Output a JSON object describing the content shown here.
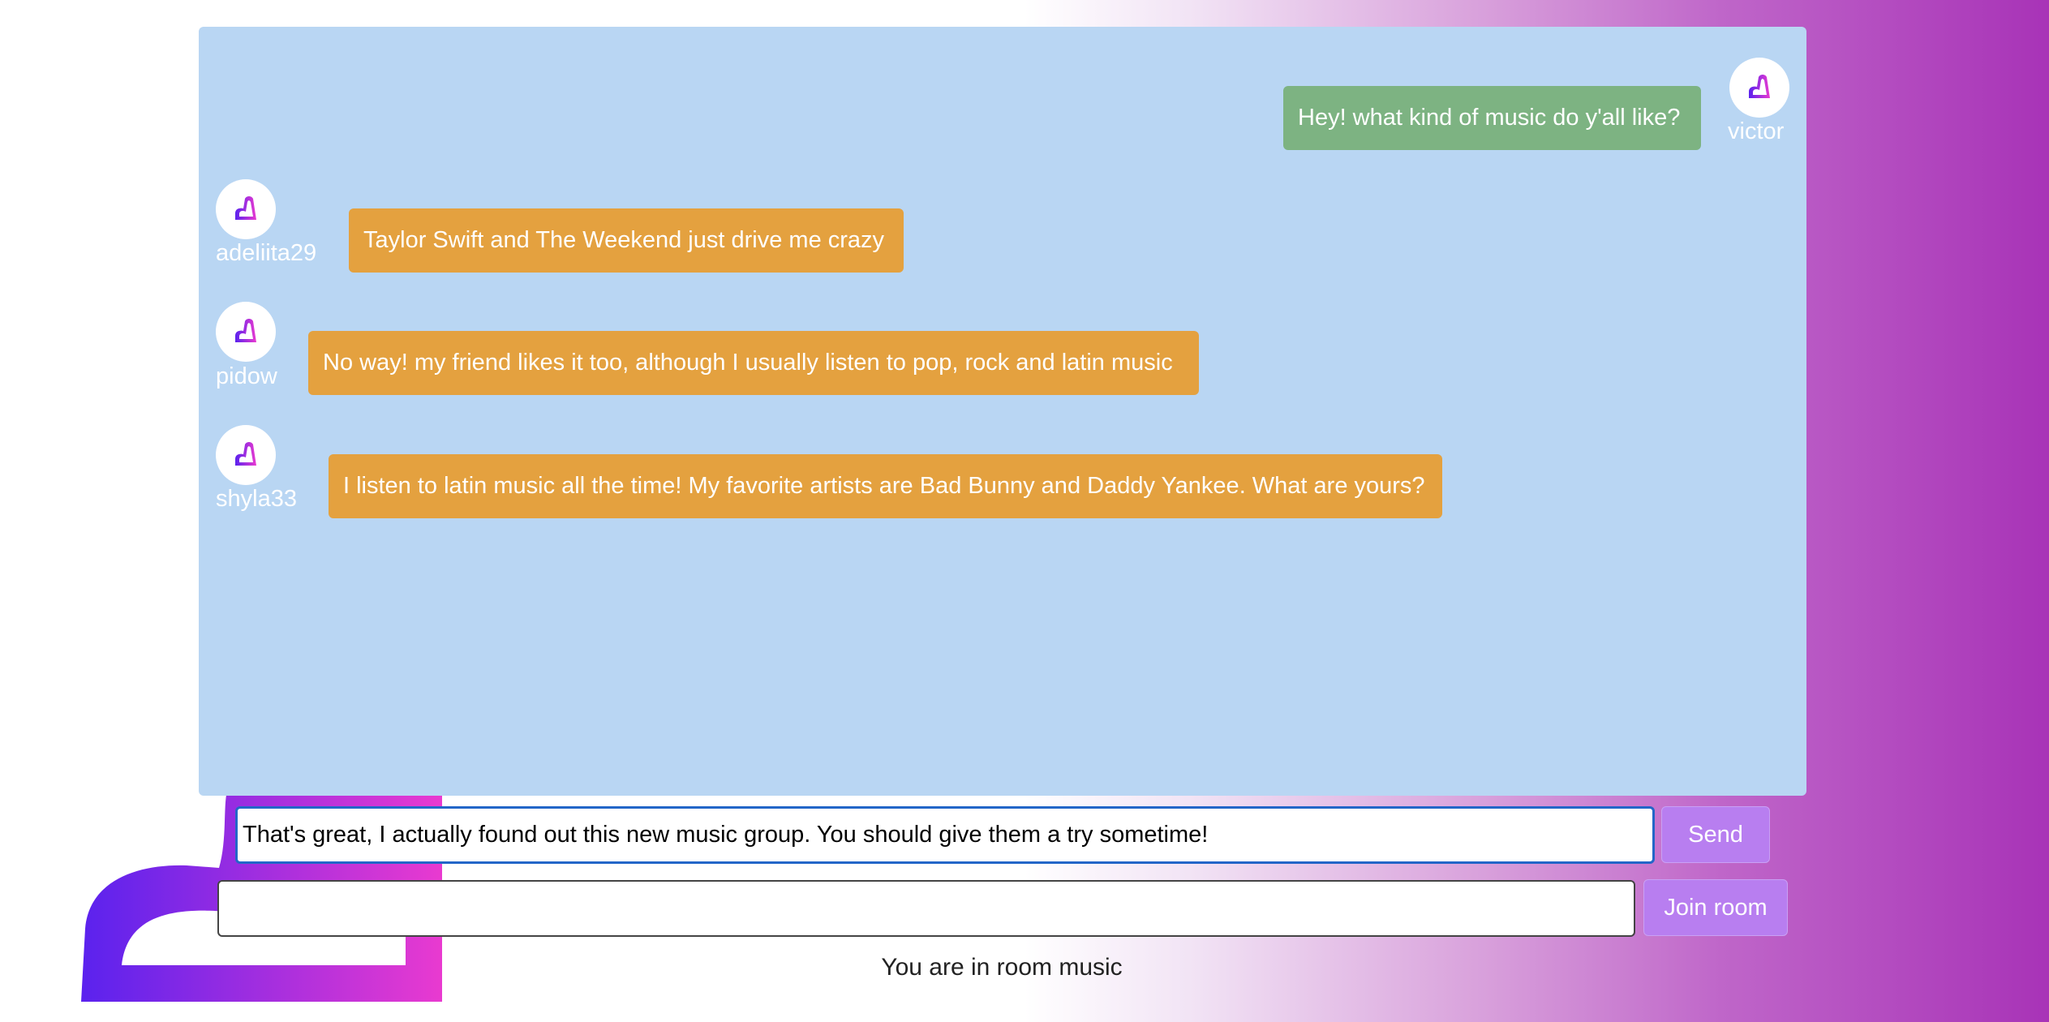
{
  "colors": {
    "panel": "#b9d6f3",
    "sent_bubble": "#7db382",
    "received_bubble": "#e4a13f",
    "button": "#b87ef0",
    "input_focus_border": "#2366c8"
  },
  "icons": {
    "avatar": "heart-logo-icon",
    "background": "heart-logo-icon"
  },
  "messages": [
    {
      "user": "victor",
      "text": "Hey! what kind of music do y'all like?",
      "direction": "sent"
    },
    {
      "user": "adeliita29",
      "text": "Taylor Swift and The Weekend just drive me crazy",
      "direction": "received"
    },
    {
      "user": "pidow",
      "text": "No way! my friend likes it too, although I usually listen to pop, rock and latin music",
      "direction": "received"
    },
    {
      "user": "shyla33",
      "text": "I listen to latin music all the time! My favorite artists are Bad Bunny and Daddy Yankee. What are yours?",
      "direction": "received"
    }
  ],
  "composer": {
    "message_value": "That's great, I actually found out this new music group. You should give them a try sometime!",
    "send_label": "Send",
    "room_value": "",
    "join_label": "Join room"
  },
  "status": {
    "room_text": "You are in room music"
  }
}
